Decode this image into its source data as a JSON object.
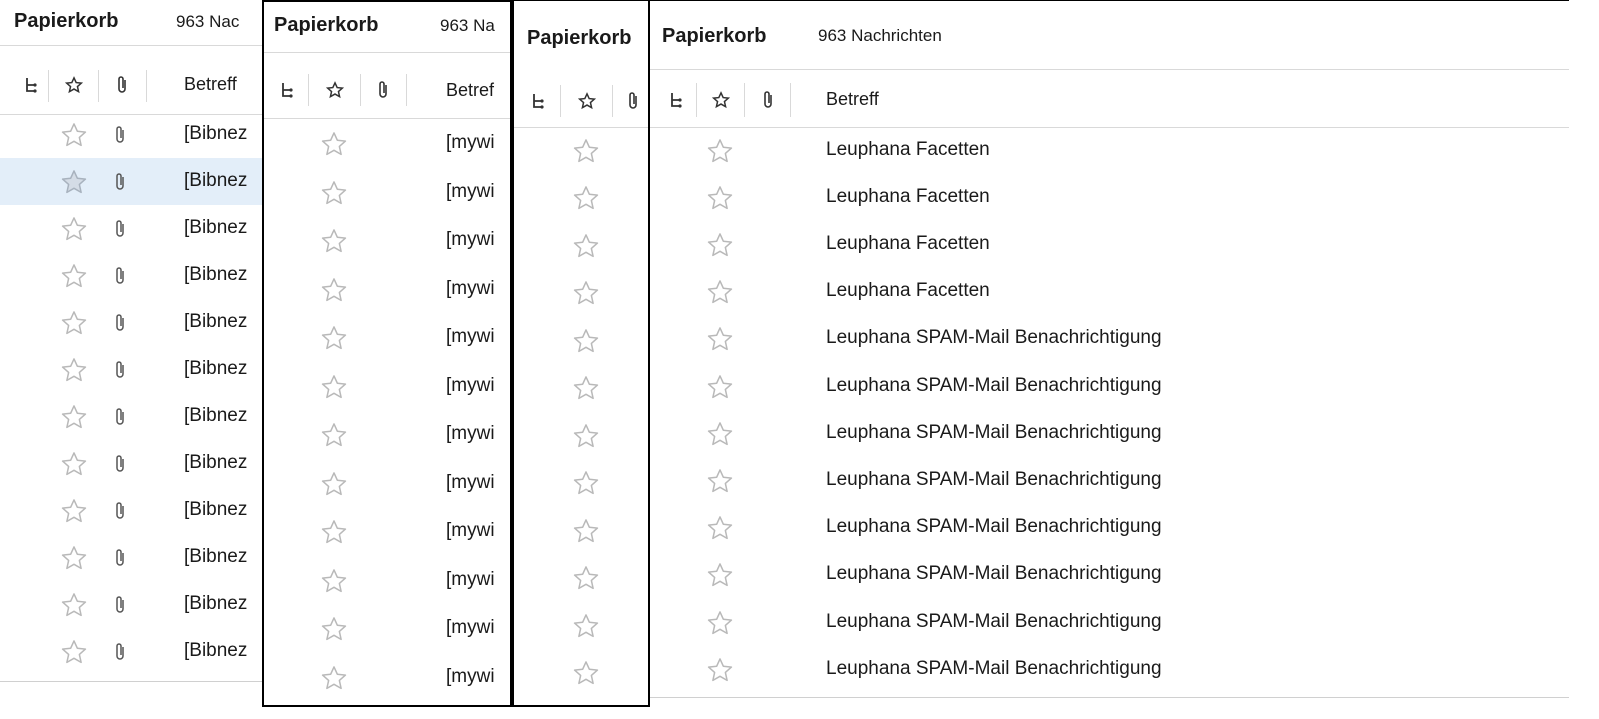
{
  "panes": [
    {
      "folder": "Papierkorb",
      "count": "963 Nac",
      "betreff_header": "Betreff",
      "subjects": [
        "[Bibnez",
        "[Bibnez",
        "[Bibnez",
        "[Bibnez",
        "[Bibnez",
        "[Bibnez",
        "[Bibnez",
        "[Bibnez",
        "[Bibnez",
        "[Bibnez",
        "[Bibnez",
        "[Bibnez"
      ],
      "selected_row": 1
    },
    {
      "folder": "Papierkorb",
      "count": "963 Na",
      "betreff_header": "Betref",
      "subjects": [
        "[mywi",
        "[mywi",
        "[mywi",
        "[mywi",
        "[mywi",
        "[mywi",
        "[mywi",
        "[mywi",
        "[mywi",
        "[mywi",
        "[mywi",
        "[mywi"
      ]
    },
    {
      "folder": "Papierkorb"
    },
    {
      "folder": "Papierkorb",
      "count": "963 Nachrichten",
      "betreff_header": "Betreff",
      "subjects": [
        "Leuphana Facetten",
        "Leuphana Facetten",
        "Leuphana Facetten",
        "Leuphana Facetten",
        "Leuphana SPAM-Mail Benachrichtigung",
        "Leuphana SPAM-Mail Benachrichtigung",
        "Leuphana SPAM-Mail Benachrichtigung",
        "Leuphana SPAM-Mail Benachrichtigung",
        "Leuphana SPAM-Mail Benachrichtigung",
        "Leuphana SPAM-Mail Benachrichtigung",
        "Leuphana SPAM-Mail Benachrichtigung",
        "Leuphana SPAM-Mail Benachrichtigung"
      ]
    }
  ],
  "icons": {
    "thread_column": "thread-icon",
    "star_column": "star-icon",
    "attachment_column": "paperclip-icon",
    "row_star": "star-outline-icon",
    "row_attachment": "paperclip-icon"
  },
  "colors": {
    "selected_row": "#e3eef9",
    "star_outline": "#b9b9b9",
    "separator": "#d9d9d9"
  }
}
